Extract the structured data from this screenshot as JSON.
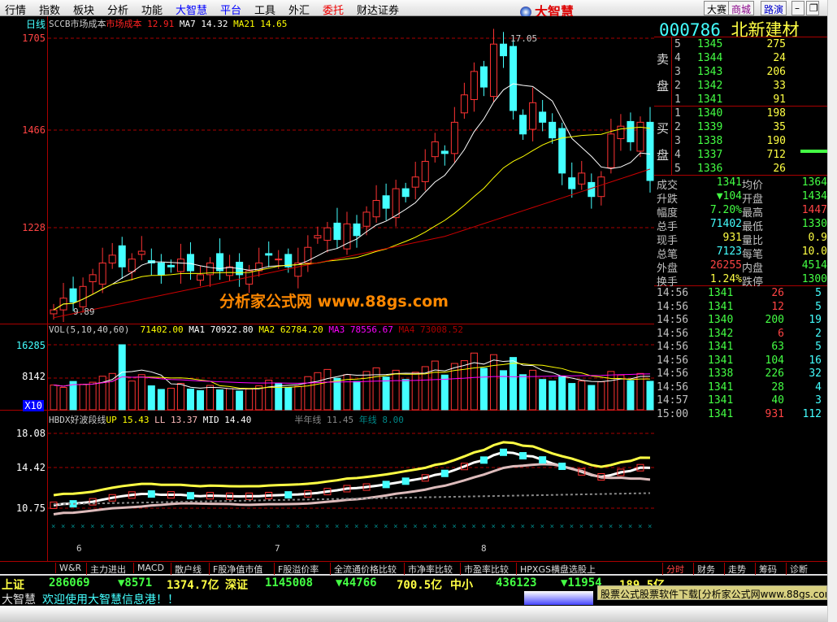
{
  "menu": [
    "行情",
    "指数",
    "板块",
    "分析",
    "功能",
    "大智慧",
    "平台",
    "工具",
    "外汇",
    "委托",
    "财达证券"
  ],
  "menu_colors": [
    "#000",
    "#000",
    "#000",
    "#000",
    "#000",
    "#00f",
    "#00f",
    "#000",
    "#000",
    "#e00",
    "#000"
  ],
  "brand": "大智慧",
  "toolbar_buttons": [
    "大赛",
    "商城",
    "路演"
  ],
  "period": "日线",
  "main_legend": {
    "name": "SCCB市场成本",
    "cost_label": "市场成本",
    "cost": "12.91",
    "ma7_label": "MA7",
    "ma7": "14.32",
    "ma21_label": "MA21",
    "ma21": "14.65"
  },
  "price_axis": [
    "1705",
    "1466",
    "1228"
  ],
  "peak_label": "17.05",
  "low_label": "9.89",
  "date_labels": [
    "6",
    "7",
    "8"
  ],
  "watermark": "分析家公式网 www.88gs.com",
  "vol_legend": {
    "name": "VOL(5,10,40,60)",
    "vol": "71402.00",
    "ma1_label": "MA1",
    "ma1": "70922.80",
    "ma2_label": "MA2",
    "ma2": "62784.20",
    "ma3_label": "MA3",
    "ma3": "78556.67",
    "ma4_label": "MA4",
    "ma4": "73008.52"
  },
  "vol_axis": [
    "16285",
    "8142",
    "X10"
  ],
  "ind_legend": {
    "name": "HBDX好波段线",
    "up_label": "UP",
    "up": "15.43",
    "ll_label": "LL",
    "ll": "13.37",
    "mid_label": "MID",
    "mid": "14.40",
    "half_label": "半年线",
    "half": "11.45",
    "year_label": "年线",
    "year": "8.00"
  },
  "ind_axis": [
    "18.08",
    "14.42",
    "10.75"
  ],
  "chart_data": {
    "type": "candlestick",
    "price_range": [
      9.82,
      17.5
    ],
    "closes": [
      10.1,
      10.4,
      10.3,
      10.7,
      11.0,
      11.3,
      11.5,
      11.2,
      11.4,
      11.6,
      11.3,
      11.0,
      11.2,
      11.4,
      11.1,
      11.0,
      11.3,
      11.1,
      11.2,
      11.0,
      11.1,
      11.3,
      11.5,
      11.4,
      11.2,
      11.3,
      11.7,
      12.0,
      12.2,
      11.9,
      12.3,
      12.0,
      12.6,
      12.9,
      12.7,
      13.2,
      13.0,
      13.5,
      13.9,
      14.4,
      14.1,
      14.9,
      15.6,
      16.2,
      15.8,
      16.9,
      16.6,
      15.2,
      14.6,
      15.4,
      14.9,
      14.5,
      13.6,
      13.2,
      13.6,
      13.0,
      13.5,
      14.6,
      14.8,
      14.4,
      14.9,
      13.41
    ],
    "volumes": [
      6200,
      5600,
      7100,
      6400,
      6900,
      8400,
      9100,
      16285,
      7200,
      8800,
      6000,
      5100,
      5400,
      6600,
      5200,
      4800,
      6100,
      5000,
      5300,
      4700,
      5200,
      6000,
      7400,
      6600,
      5500,
      5900,
      8300,
      9300,
      10100,
      7900,
      8800,
      7100,
      9600,
      10500,
      8200,
      9900,
      7600,
      9400,
      10800,
      12200,
      8700,
      11600,
      12300,
      14200,
      10400,
      13800,
      9800,
      13100,
      8800,
      9900,
      7600,
      7200,
      8400,
      6600,
      7200,
      6100,
      7000,
      9600,
      8700,
      7300,
      9100,
      7140
    ]
  },
  "stock": {
    "code": "000786",
    "name": "北新建材"
  },
  "sell_label": [
    "卖",
    "盘"
  ],
  "buy_label": [
    "买",
    "盘"
  ],
  "asks": [
    {
      "lvl": "5",
      "price": "1345",
      "vol": "275"
    },
    {
      "lvl": "4",
      "price": "1344",
      "vol": "24"
    },
    {
      "lvl": "3",
      "price": "1343",
      "vol": "206"
    },
    {
      "lvl": "2",
      "price": "1342",
      "vol": "33"
    },
    {
      "lvl": "1",
      "price": "1341",
      "vol": "91"
    }
  ],
  "bids": [
    {
      "lvl": "1",
      "price": "1340",
      "vol": "198"
    },
    {
      "lvl": "2",
      "price": "1339",
      "vol": "35"
    },
    {
      "lvl": "3",
      "price": "1338",
      "vol": "190"
    },
    {
      "lvl": "4",
      "price": "1337",
      "vol": "712"
    },
    {
      "lvl": "5",
      "price": "1336",
      "vol": "26"
    }
  ],
  "stats": [
    {
      "l": "成交",
      "v": "1341",
      "c": "g",
      "l2": "均价",
      "v2": "1364",
      "c2": "g"
    },
    {
      "l": "升跌",
      "v": "▼104",
      "c": "g",
      "l2": "开盘",
      "v2": "1434",
      "c2": "g"
    },
    {
      "l": "幅度",
      "v": "7.20%",
      "c": "g",
      "l2": "最高",
      "v2": "1447",
      "c2": "r"
    },
    {
      "l": "总手",
      "v": "71402",
      "c": "c",
      "l2": "最低",
      "v2": "1330",
      "c2": "g"
    },
    {
      "l": "现手",
      "v": "931",
      "c": "y",
      "l2": "量比",
      "v2": "0.9",
      "c2": "y"
    },
    {
      "l": "总笔",
      "v": "7123",
      "c": "c",
      "l2": "每笔",
      "v2": "10.0",
      "c2": "y"
    },
    {
      "l": "外盘",
      "v": "26255",
      "c": "r",
      "l2": "内盘",
      "v2": "4514",
      "c2": "g"
    },
    {
      "l": "换手",
      "v": "1.24%",
      "c": "y",
      "l2": "跌停",
      "v2": "1300",
      "c2": "g"
    }
  ],
  "ticks": [
    {
      "t": "14:56",
      "p": "1341",
      "v": "26",
      "vc": "r",
      "n": "5"
    },
    {
      "t": "14:56",
      "p": "1341",
      "v": "12",
      "vc": "r",
      "n": "5"
    },
    {
      "t": "14:56",
      "p": "1340",
      "v": "200",
      "vc": "g",
      "n": "19"
    },
    {
      "t": "14:56",
      "p": "1342",
      "v": "6",
      "vc": "r",
      "n": "2"
    },
    {
      "t": "14:56",
      "p": "1341",
      "v": "63",
      "vc": "g",
      "n": "5"
    },
    {
      "t": "14:56",
      "p": "1341",
      "v": "104",
      "vc": "g",
      "n": "16"
    },
    {
      "t": "14:56",
      "p": "1338",
      "v": "226",
      "vc": "g",
      "n": "32"
    },
    {
      "t": "14:56",
      "p": "1341",
      "v": "28",
      "vc": "g",
      "n": "4"
    },
    {
      "t": "14:57",
      "p": "1341",
      "v": "40",
      "vc": "g",
      "n": "3"
    },
    {
      "t": "15:00",
      "p": "1341",
      "v": "931",
      "vc": "r",
      "n": "112"
    }
  ],
  "indicator_tabs": [
    "W&R",
    "主力进出",
    "MACD",
    "散户线",
    "F股净值市值",
    "F股溢价率",
    "全流通价格比较",
    "市净率比较",
    "市盈率比较",
    "HPXGS横盘选股上"
  ],
  "right_tabs": [
    "分时",
    "财务",
    "走势",
    "筹码",
    "诊断"
  ],
  "market": {
    "sh_label": "上证",
    "sh_vol": "286069",
    "sh_chg": "▼8571",
    "sh_amt": "1374.7亿",
    "sz_label": "深证",
    "sz_vol": "1145008",
    "sz_chg": "▼44766",
    "sz_amt": "700.5亿",
    "zx_label": "中小",
    "zx_vol": "436123",
    "zx_chg": "▼11954",
    "zx_amt": "189.5亿"
  },
  "ticker": {
    "label": "大智慧",
    "message": "欢迎使用大智慧信息港！！"
  },
  "ad_banner": "股票公式股票软件下载[分析家公式网www.88gs.com]"
}
